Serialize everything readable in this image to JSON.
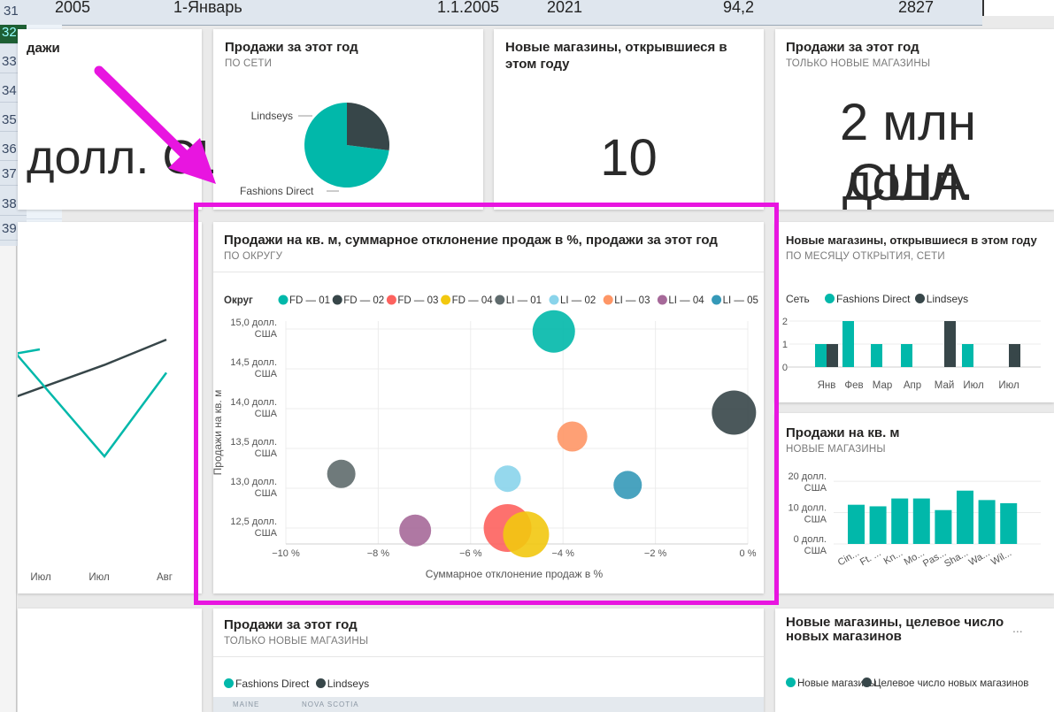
{
  "spreadsheet": {
    "top_row": {
      "row": "31",
      "year": "2005",
      "month": "1-Январь",
      "date": "1.1.2005",
      "val1": "2021",
      "val2": "94,2",
      "val3": "2827"
    },
    "row_numbers": [
      "32",
      "33",
      "34",
      "35",
      "36",
      "37",
      "38",
      "39"
    ]
  },
  "cards": {
    "left_top": {
      "title_fragment": "дажи",
      "value_fragment": "долл. США"
    },
    "sales_this_year": {
      "title": "Продажи за этот год",
      "subtitle": "ПО СЕТИ",
      "pie": {
        "label_lindseys": "Lindseys",
        "label_fd": "Fashions Direct",
        "slices": [
          {
            "name": "Fashions Direct",
            "value": 73,
            "color": "#01b8aa"
          },
          {
            "name": "Lindseys",
            "value": 27,
            "color": "#374649"
          }
        ]
      }
    },
    "new_stores": {
      "title": "Новые магазины, открывшиеся в этом году",
      "value": "10"
    },
    "sales_new_stores": {
      "title": "Продажи за этот год",
      "subtitle": "ТОЛЬКО НОВЫЕ МАГАЗИНЫ",
      "value_line1": "2 млн долл.",
      "value_line2": "США"
    },
    "left_line": {
      "x_labels": [
        "Июл",
        "Июл",
        "Авг"
      ]
    },
    "scatter": {
      "title": "Продажи на кв. м, суммарное отклонение продаж в %, продажи за этот год",
      "subtitle": "ПО ОКРУГУ",
      "legend_title": "Округ"
    },
    "new_stores_month": {
      "title": "Новые магазины, открывшиеся в этом году",
      "subtitle": "ПО МЕСЯЦУ ОТКРЫТИЯ, СЕТИ",
      "legend_label": "Сеть",
      "legend": [
        {
          "name": "Fashions Direct",
          "color": "#01b8aa"
        },
        {
          "name": "Lindseys",
          "color": "#374649"
        }
      ]
    },
    "sales_sqm": {
      "title": "Продажи на кв. м",
      "subtitle": "НОВЫЕ МАГАЗИНЫ"
    },
    "bottom_sales": {
      "title": "Продажи за этот год",
      "subtitle": "ТОЛЬКО НОВЫЕ МАГАЗИНЫ",
      "legend": [
        {
          "name": "Fashions Direct",
          "color": "#01b8aa"
        },
        {
          "name": "Lindseys",
          "color": "#374649"
        }
      ],
      "map_labels": [
        "MAINE",
        "NOVA SCOTIA"
      ]
    },
    "bottom_target": {
      "title_line1": "Новые магазины, целевое число",
      "title_line2": "новых магазинов",
      "more": "...",
      "legend_a": "Новые магазины",
      "legend_b": "Целевое число новых магазинов",
      "color_a": "#01b8aa",
      "color_b": "#374649"
    }
  },
  "chart_data": [
    {
      "type": "scatter",
      "title": "Продажи на кв. м, суммарное отклонение продаж в %, продажи за этот год",
      "xlabel": "Суммарное отклонение продаж в %",
      "ylabel": "Продажи на кв. м",
      "xlim": [
        -10,
        0
      ],
      "ylim": [
        12.3,
        15.1
      ],
      "x_ticks": [
        {
          "v": -10,
          "label": "−10 %"
        },
        {
          "v": -8,
          "label": "−8 %"
        },
        {
          "v": -6,
          "label": "−6 %"
        },
        {
          "v": -4,
          "label": "−4 %"
        },
        {
          "v": -2,
          "label": "−2 %"
        },
        {
          "v": 0,
          "label": "0 %"
        }
      ],
      "y_ticks": [
        {
          "v": 15.0,
          "l1": "15,0 долл.",
          "l2": "США"
        },
        {
          "v": 14.5,
          "l1": "14,5 долл.",
          "l2": "США"
        },
        {
          "v": 14.0,
          "l1": "14,0 долл.",
          "l2": "США"
        },
        {
          "v": 13.5,
          "l1": "13,5 долл.",
          "l2": "США"
        },
        {
          "v": 13.0,
          "l1": "13,0 долл.",
          "l2": "США"
        },
        {
          "v": 12.5,
          "l1": "12,5 долл.",
          "l2": "США"
        }
      ],
      "series": [
        {
          "name": "FD — 01",
          "color": "#01b8aa",
          "x": -4.2,
          "y": 14.97,
          "size": 24
        },
        {
          "name": "FD — 02",
          "color": "#374649",
          "x": -0.3,
          "y": 13.95,
          "size": 25
        },
        {
          "name": "FD — 03",
          "color": "#fd625e",
          "x": -5.2,
          "y": 12.5,
          "size": 27
        },
        {
          "name": "FD — 04",
          "color": "#f2c80f",
          "x": -4.8,
          "y": 12.42,
          "size": 26
        },
        {
          "name": "LI — 01",
          "color": "#5f6b6d",
          "x": -8.8,
          "y": 13.18,
          "size": 16
        },
        {
          "name": "LI — 02",
          "color": "#8ad4eb",
          "x": -5.2,
          "y": 13.12,
          "size": 15
        },
        {
          "name": "LI — 03",
          "color": "#fe9666",
          "x": -3.8,
          "y": 13.65,
          "size": 17
        },
        {
          "name": "LI — 04",
          "color": "#a66999",
          "x": -7.2,
          "y": 12.47,
          "size": 18
        },
        {
          "name": "LI — 05",
          "color": "#3599b8",
          "x": -2.6,
          "y": 13.04,
          "size": 16
        }
      ]
    },
    {
      "type": "bar",
      "title": "Новые магазины, открывшиеся в этом году",
      "categories": [
        "Янв",
        "Фев",
        "Мар",
        "Апр",
        "Май",
        "Июл",
        "Июл"
      ],
      "ylim": [
        0,
        2
      ],
      "y_ticks": [
        "0",
        "1",
        "2"
      ],
      "series": [
        {
          "name": "Fashions Direct",
          "color": "#01b8aa",
          "values": [
            1,
            2,
            1,
            1,
            0,
            1,
            0
          ]
        },
        {
          "name": "Lindseys",
          "color": "#374649",
          "values": [
            1,
            0,
            0,
            0,
            2,
            0,
            1
          ]
        }
      ]
    },
    {
      "type": "bar",
      "title": "Продажи на кв. м",
      "categories": [
        "Cin...",
        "Ft. ...",
        "Kn...",
        "Mo...",
        "Pas...",
        "Sha...",
        "Wa...",
        "Wil..."
      ],
      "ylim": [
        0,
        22
      ],
      "y_ticks": [
        {
          "v": 20,
          "l1": "20 долл.",
          "l2": "США"
        },
        {
          "v": 10,
          "l1": "10 долл.",
          "l2": "США"
        },
        {
          "v": 0,
          "l1": "0 долл.",
          "l2": "США"
        }
      ],
      "series": [
        {
          "name": "Продажи на кв. м",
          "color": "#01b8aa",
          "values": [
            12.5,
            12,
            14.5,
            14.5,
            10.8,
            17,
            14,
            13
          ]
        }
      ]
    },
    {
      "type": "line",
      "categories": [
        "Июл",
        "Июл",
        "Авг"
      ],
      "series": [
        {
          "name": "Lindseys",
          "color": "#374649",
          "values": [
            0.55,
            0.72,
            0.85
          ]
        },
        {
          "name": "Fashions Direct",
          "color": "#01b8aa",
          "values": [
            0.8,
            0.25,
            0.68
          ]
        }
      ]
    }
  ]
}
